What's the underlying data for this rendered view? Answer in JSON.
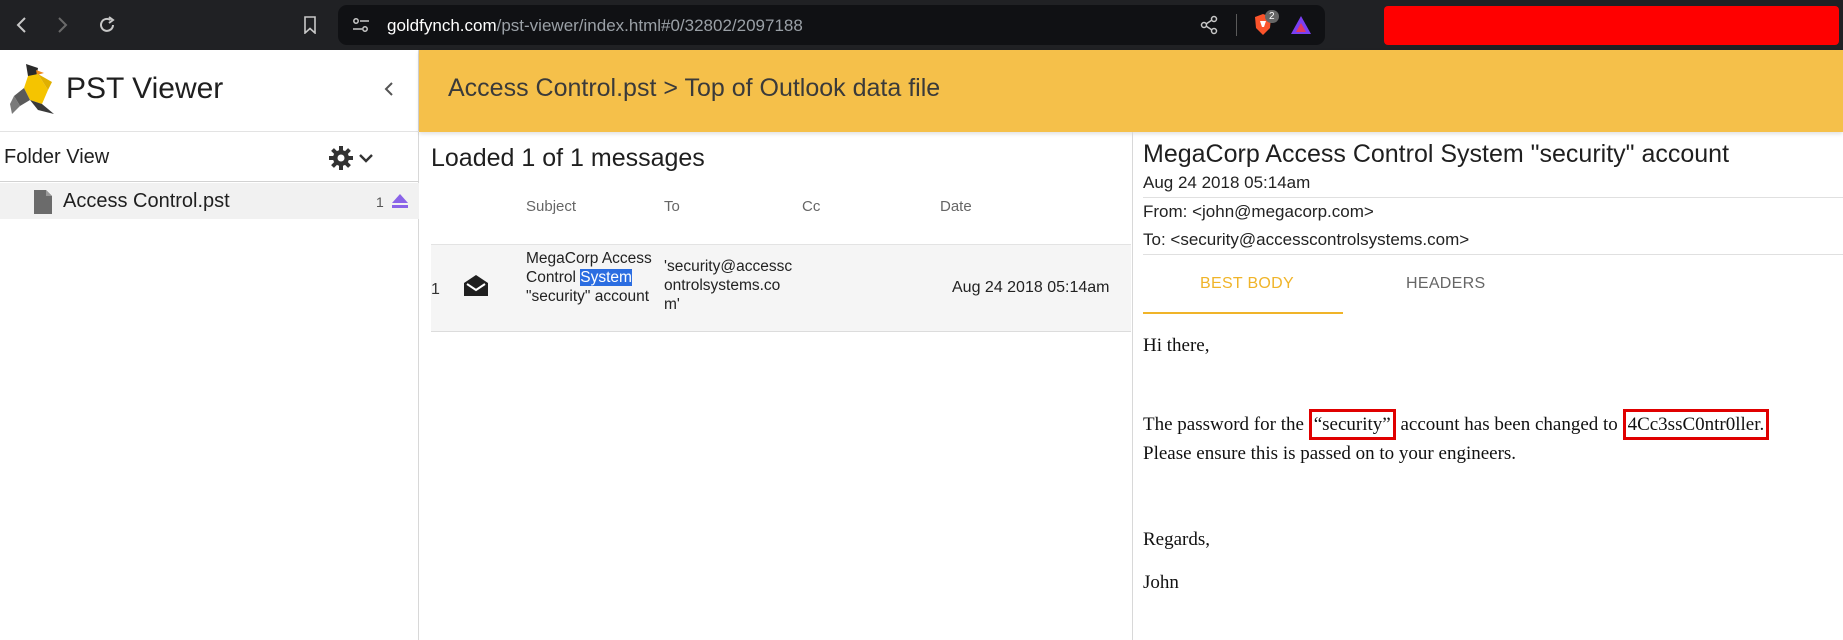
{
  "browser": {
    "url_host": "goldfynch.com",
    "url_path": "/pst-viewer/index.html#0/32802/2097188",
    "brave_badge": "2",
    "redacted_color": "#ff0000"
  },
  "sidebar": {
    "app_title": "PST Viewer",
    "folder_view_label": "Folder View",
    "tree": [
      {
        "label": "Access Control.pst",
        "count": "1"
      }
    ]
  },
  "header": {
    "breadcrumb": "Access Control.pst > Top of Outlook data file",
    "accent_color": "#f5c04a"
  },
  "list": {
    "loaded_text": "Loaded 1 of 1 messages",
    "columns": [
      "Subject",
      "To",
      "Cc",
      "Date"
    ],
    "rows": [
      {
        "num": "1",
        "subject_pre": "MegaCorp Access Control ",
        "subject_highlight": "System",
        "subject_post": " \"security\" account",
        "to": "'security@accesscontrolsystems.com'",
        "cc": "",
        "date": "Aug 24 2018 05:14am"
      }
    ]
  },
  "message": {
    "title": "MegaCorp Access Control System \"security\" account",
    "date": "Aug 24 2018 05:14am",
    "from": "From: <john@megacorp.com>",
    "to": "To: <security@accesscontrolsystems.com>",
    "tabs": [
      "BEST BODY",
      "HEADERS"
    ],
    "body": {
      "greeting": "Hi there,",
      "line1_pre": "The password for the ",
      "line1_box1": "“security”",
      "line1_mid": " account has been changed to ",
      "line1_box2": "4Cc3ssC0ntr0ller.",
      "line2": "Please ensure this is passed on to your engineers.",
      "regards": "Regards,",
      "signature": "John"
    }
  }
}
